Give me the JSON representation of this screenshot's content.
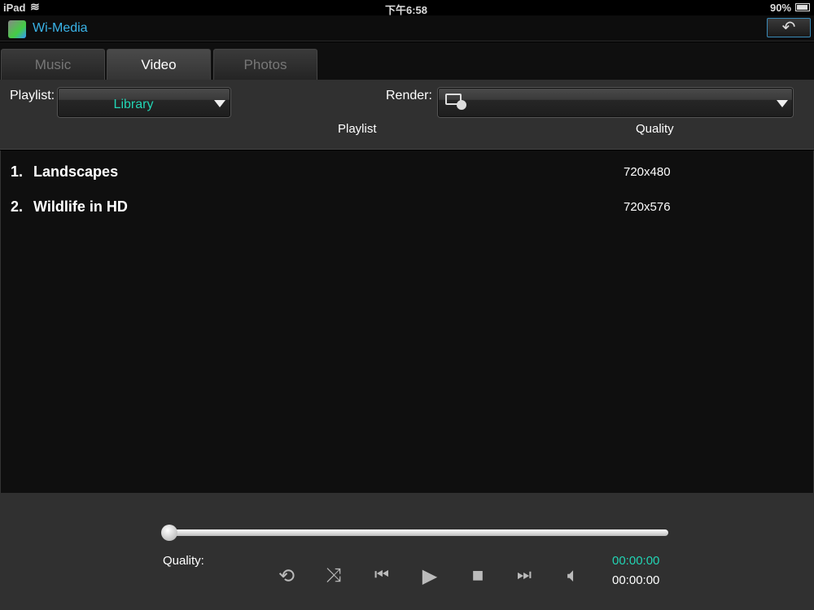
{
  "status": {
    "device": "iPad",
    "time": "下午6:58",
    "battery": "90%"
  },
  "app": {
    "title": "Wi-Media"
  },
  "tabs": [
    {
      "label": "Music"
    },
    {
      "label": "Video"
    },
    {
      "label": "Photos"
    }
  ],
  "controls": {
    "playlist_label": "Playlist:",
    "playlist_value": "Library",
    "render_label": "Render:",
    "col_playlist": "Playlist",
    "col_quality": "Quality"
  },
  "items": [
    {
      "index": "1.",
      "title": "Landscapes",
      "quality": "720x480"
    },
    {
      "index": "2.",
      "title": "Wildlife in HD",
      "quality": "720x576"
    }
  ],
  "player": {
    "quality_label": "Quality:",
    "elapsed": "00:00:00",
    "total": "00:00:00",
    "progress": 0
  },
  "colors": {
    "accent": "#22d4b4",
    "title": "#3ab4e8"
  }
}
